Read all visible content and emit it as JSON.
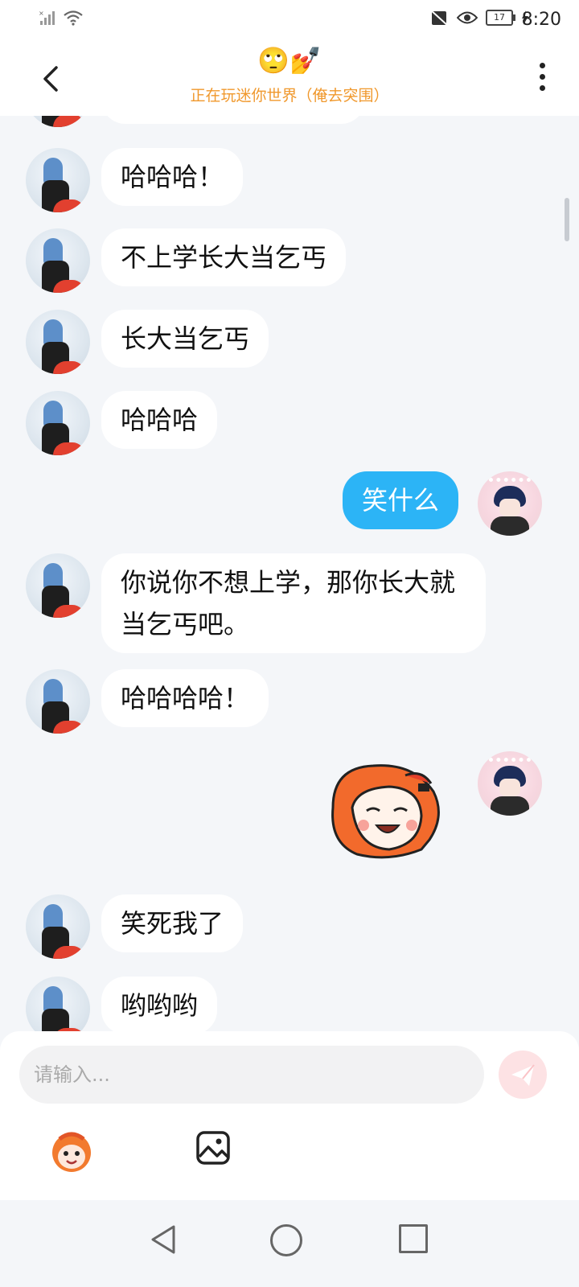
{
  "status_bar": {
    "time": "8:20",
    "battery": "17"
  },
  "header": {
    "emoji": "🙄💅",
    "status": "正在玩迷你世界（俺去突围）"
  },
  "messages": [
    {
      "side": "left",
      "text": "哈哈哈！"
    },
    {
      "side": "left",
      "text": "不上学长大当乞丐"
    },
    {
      "side": "left",
      "text": "长大当乞丐"
    },
    {
      "side": "left",
      "text": "哈哈哈"
    },
    {
      "side": "right",
      "text": "笑什么"
    },
    {
      "side": "left",
      "text": "你说你不想上学，那你长大就当乞丐吧。"
    },
    {
      "side": "left",
      "text": "哈哈哈哈！"
    },
    {
      "side": "right",
      "type": "sticker",
      "icon": "laughing-character-sticker"
    },
    {
      "side": "left",
      "text": "笑死我了"
    },
    {
      "side": "left",
      "text": "哟哟哟"
    }
  ],
  "composer": {
    "placeholder": "请输入..."
  },
  "colors": {
    "accent_orange": "#f0982c",
    "my_bubble": "#2cb4f6",
    "background": "#f4f6f9"
  }
}
